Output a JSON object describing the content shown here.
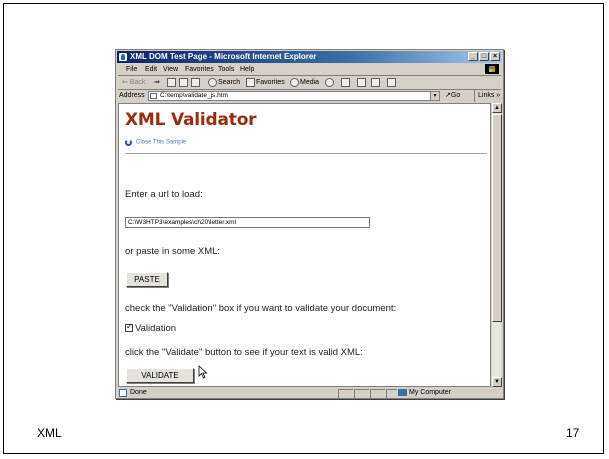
{
  "slide": {
    "footer_left": "XML",
    "page_number": "17"
  },
  "window": {
    "title": "XML DOM Test Page - Microsoft Internet Explorer",
    "controls": [
      "_",
      "□",
      "×"
    ]
  },
  "menu": {
    "items": [
      "File",
      "Edit",
      "View",
      "Favorites",
      "Tools",
      "Help"
    ]
  },
  "toolbar": {
    "back": "⇐ Back",
    "forward": "⇒",
    "search": "Search",
    "favorites": "Favorites",
    "media": "Media"
  },
  "address": {
    "label": "Address",
    "value": "C:\\temp\\validate_js.htm",
    "go": "Go",
    "links": "Links »"
  },
  "page": {
    "heading": "XML Validator",
    "close_sample": "Close This Sample",
    "enter_url_prompt": "Enter a url to load:",
    "url_value": "C:\\W3HTP3\\examples\\ch20\\letter.xml",
    "paste_prompt": "or paste in some XML:",
    "paste_button": "PASTE",
    "validation_prompt": "check the \"Validation\" box if you want to validate your document:",
    "validation_label": "Validation",
    "validation_checked": true,
    "validate_prompt": "click the \"Validate\" button to see if your text is valid XML:",
    "validate_button": "VALIDATE"
  },
  "status": {
    "text": "Done",
    "zone": "My Computer"
  }
}
